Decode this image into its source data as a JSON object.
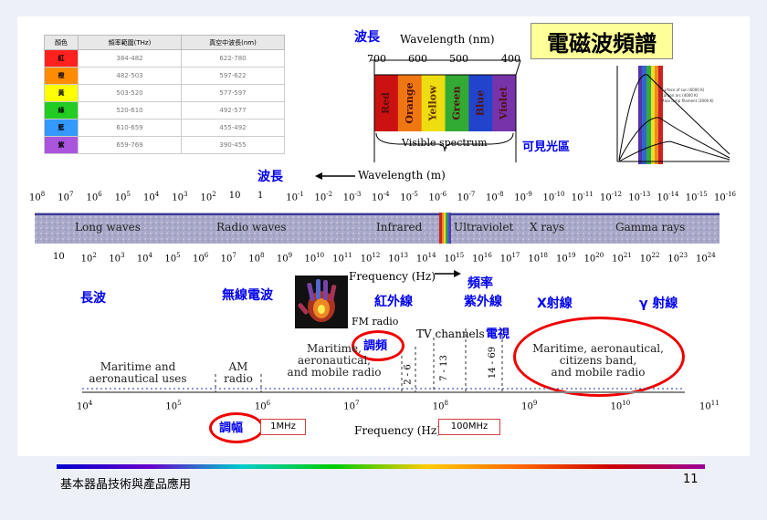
{
  "slide": {
    "title": "電磁波頻譜",
    "footer_left": "基本器晶技術與產品應用",
    "page_number": "11"
  },
  "color_table": {
    "headers": [
      "顏色",
      "頻率範圍(THz)",
      "真空中波長(nm)"
    ],
    "rows": [
      {
        "name": "紅",
        "freq": "384-482",
        "wave": "622-780",
        "color": "#ff2020"
      },
      {
        "name": "橙",
        "freq": "482-503",
        "wave": "597-622",
        "color": "#ff8c00"
      },
      {
        "name": "黃",
        "freq": "503-520",
        "wave": "577-597",
        "color": "#ffff00"
      },
      {
        "name": "綠",
        "freq": "520-610",
        "wave": "492-577",
        "color": "#22cc22"
      },
      {
        "name": "藍",
        "freq": "610-659",
        "wave": "455-492",
        "color": "#3399ff"
      },
      {
        "name": "紫",
        "freq": "659-769",
        "wave": "390-455",
        "color": "#aa55dd"
      }
    ]
  },
  "visible": {
    "wave_label": "波長",
    "axis_label": "Wavelength (nm)",
    "ticks": [
      "700",
      "600",
      "500",
      "400"
    ],
    "bands": [
      "Red",
      "Orange",
      "Yellow",
      "Green",
      "Blue",
      "Violet"
    ],
    "band_colors": [
      "#cc1111",
      "#ee7711",
      "#eedd11",
      "#33aa33",
      "#2244cc",
      "#7733aa"
    ],
    "caption": "Visible spectrum",
    "region_label": "可見光區"
  },
  "blackbody": {
    "legend_line1": "Surface of sun (6000 K)",
    "legend_line2": "Carbon arc (4000 K)",
    "legend_line3": "Mass lamp filament (3000 K)"
  },
  "spectrum": {
    "wave_label": "波長",
    "axis_label": "Wavelength (m)",
    "wave_ticks": [
      "10^8",
      "10^7",
      "10^6",
      "10^5",
      "10^4",
      "10^3",
      "10^2",
      "10",
      "1",
      "10^-1",
      "10^-2",
      "10^-3",
      "10^-4",
      "10^-5",
      "10^-6",
      "10^-7",
      "10^-8",
      "10^-9",
      "10^-10",
      "10^-11",
      "10^-12",
      "10^-13",
      "10^-14",
      "10^-15",
      "10^-16"
    ],
    "bands": [
      "Long waves",
      "Radio waves",
      "Infrared",
      "Ultraviolet",
      "X rays",
      "Gamma rays"
    ],
    "freq_ticks": [
      "10",
      "10^2",
      "10^3",
      "10^4",
      "10^5",
      "10^6",
      "10^7",
      "10^8",
      "10^9",
      "10^10",
      "10^11",
      "10^12",
      "10^13",
      "10^14",
      "10^15",
      "10^16",
      "10^17",
      "10^18",
      "10^19",
      "10^20",
      "10^21",
      "10^22",
      "10^23",
      "10^24"
    ],
    "freq_axis_label": "Frequency (Hz)",
    "freq_label": "頻率"
  },
  "zh_labels": {
    "long_wave": "長波",
    "radio": "無線電波",
    "infrared": "紅外線",
    "ultraviolet": "紫外線",
    "xray": "X射線",
    "gamma": "γ 射線"
  },
  "radio_detail": {
    "fm_radio": "FM radio",
    "fm_zh": "調頻",
    "tv_channels": "TV channels",
    "tv_zh": "電視",
    "maritime_aero": "Maritime and\naeronautical uses",
    "am_radio": "AM\nradio",
    "maritime_mobile": "Maritime,\naeronautical,\nand mobile radio",
    "ch_2_6": "2 - 6",
    "ch_7_13": "7 - 13",
    "ch_14_69": "14 - 69",
    "maritime_citizens": "Maritime, aeronautical,\ncitizens band,\nand mobile radio",
    "freq_ticks": [
      "10^4",
      "10^5",
      "10^6",
      "10^7",
      "10^8",
      "10^9",
      "10^10",
      "10^11"
    ],
    "freq_axis_label": "Frequency (Hz)",
    "am_zh": "調幅",
    "mhz1": "1MHz",
    "mhz100": "100MHz"
  }
}
